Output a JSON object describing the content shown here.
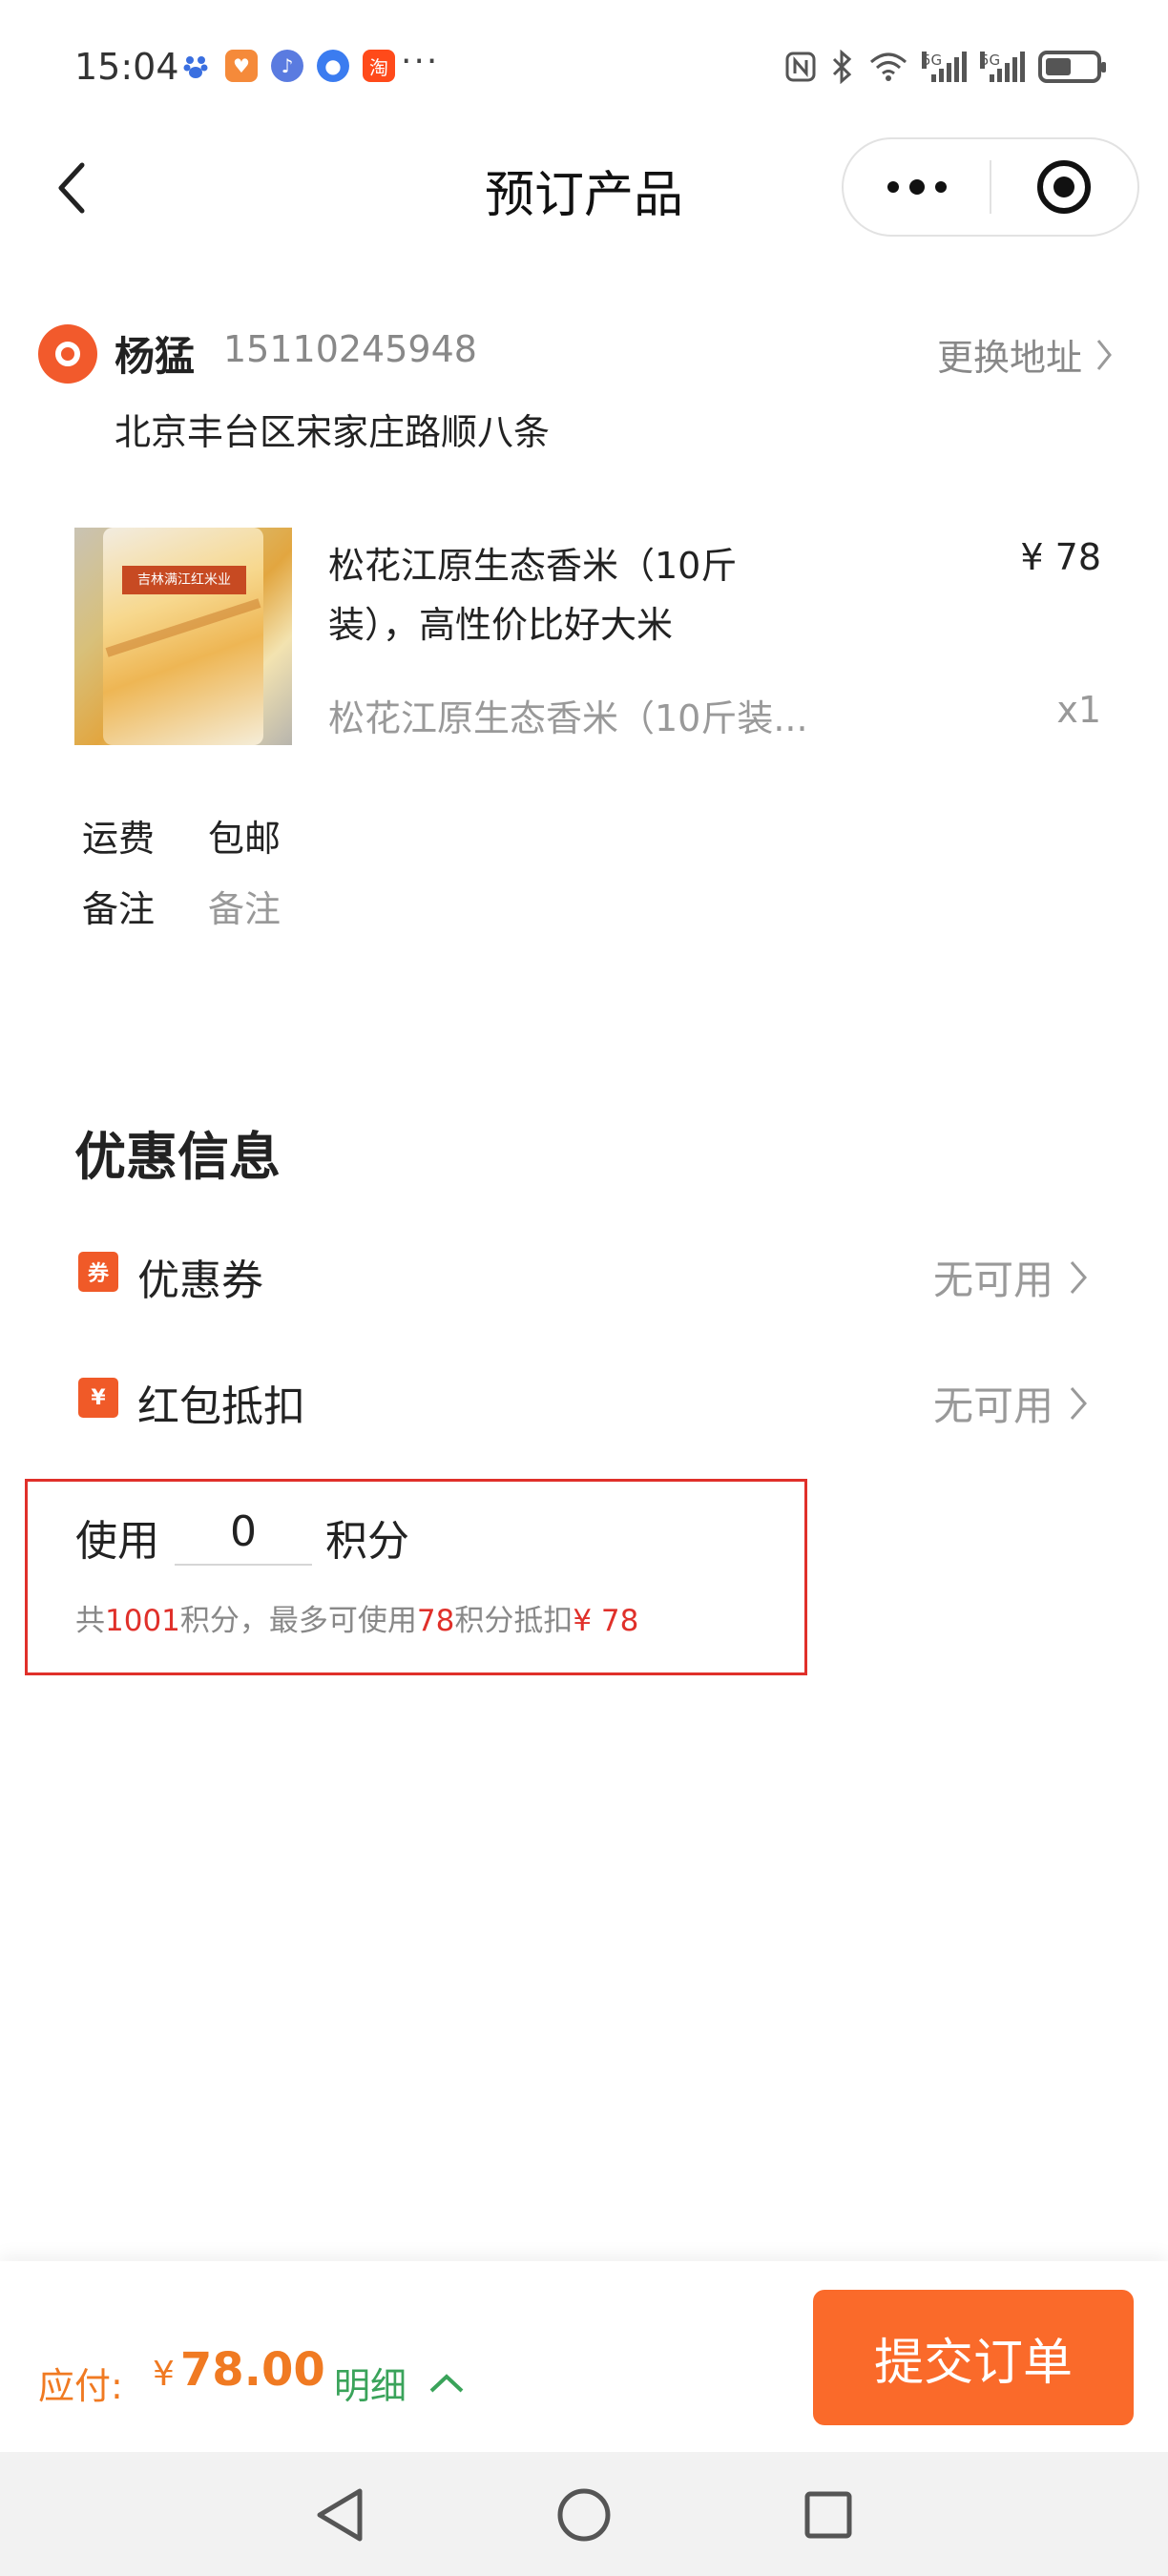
{
  "status_bar": {
    "time": "15:04",
    "more": "···",
    "network_1": "5G",
    "network_2": "5G"
  },
  "title_bar": {
    "title": "预订产品"
  },
  "address": {
    "name": "杨猛",
    "phone": "15110245948",
    "change_label": "更换地址",
    "detail": "北京丰台区宋家庄路顺八条"
  },
  "product": {
    "image_label": "吉林满江红米业",
    "title": "松花江原生态香米（10斤装），高性价比好大米",
    "price": "¥ 78",
    "spec": "松花江原生态香米（10斤装...",
    "quantity": "x1"
  },
  "order": {
    "shipping_label": "运费",
    "shipping_value": "包邮",
    "note_label": "备注",
    "note_placeholder": "备注"
  },
  "discount": {
    "title": "优惠信息",
    "coupon_icon": "券",
    "coupon_label": "优惠券",
    "coupon_value": "无可用",
    "redpacket_icon": "¥",
    "redpacket_label": "红包抵扣",
    "redpacket_value": "无可用"
  },
  "points": {
    "use_label": "使用",
    "input_value": "0",
    "unit_label": "积分",
    "info_prefix": "共",
    "total": "1001",
    "info_mid": "积分，最多可使用",
    "max_use": "78",
    "info_suffix": "积分抵扣",
    "deduct_amount": "¥ 78"
  },
  "bottom_bar": {
    "pay_label": "应付:",
    "currency": "¥",
    "amount": "78.00",
    "detail_label": "明细",
    "submit_label": "提交订单"
  },
  "colors": {
    "accent_orange": "#fa6a2a",
    "price_orange": "#f07a22",
    "highlight_red": "#e0302a",
    "detail_green": "#3aa35a"
  }
}
